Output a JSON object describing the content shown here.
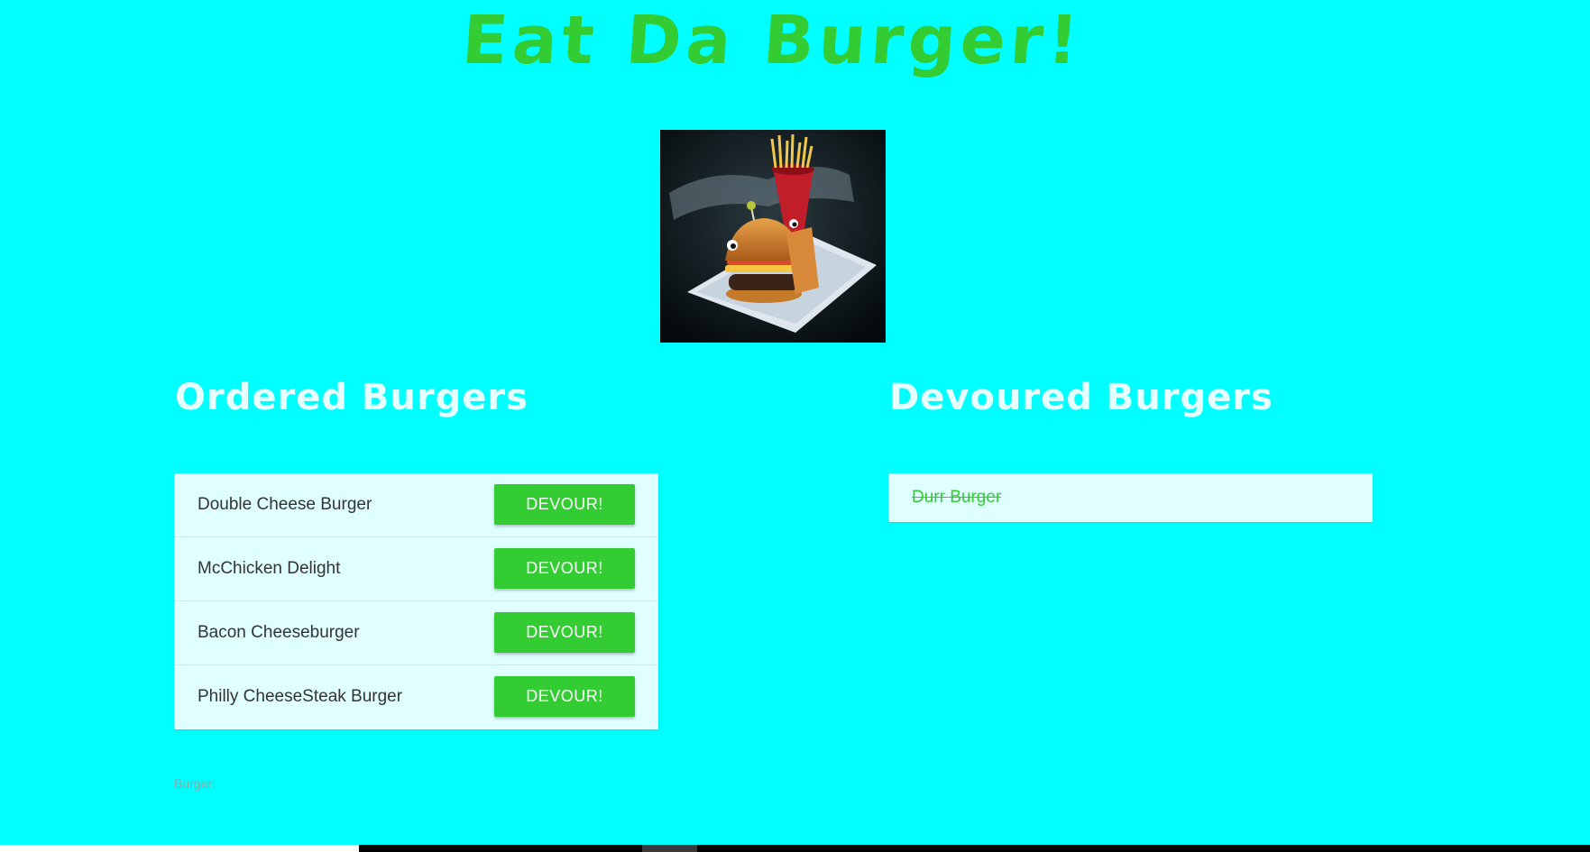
{
  "header": {
    "title": "Eat Da Burger!"
  },
  "colors": {
    "background": "#00ffff",
    "accent": "#33cc33",
    "heading": "#e6ffff",
    "card": "#e0ffff"
  },
  "hero": {
    "icon": "burger-photo"
  },
  "ordered": {
    "heading": "Ordered Burgers",
    "items": [
      {
        "name": "Double Cheese Burger",
        "button": "DEVOUR!"
      },
      {
        "name": "McChicken Delight",
        "button": "DEVOUR!"
      },
      {
        "name": "Bacon Cheeseburger",
        "button": "DEVOUR!"
      },
      {
        "name": "Philly CheeseSteak Burger",
        "button": "DEVOUR!"
      }
    ]
  },
  "devoured": {
    "heading": "Devoured Burgers",
    "items": [
      {
        "name": "Durr Burger"
      }
    ]
  },
  "form": {
    "label": "Burger:",
    "value": ""
  }
}
